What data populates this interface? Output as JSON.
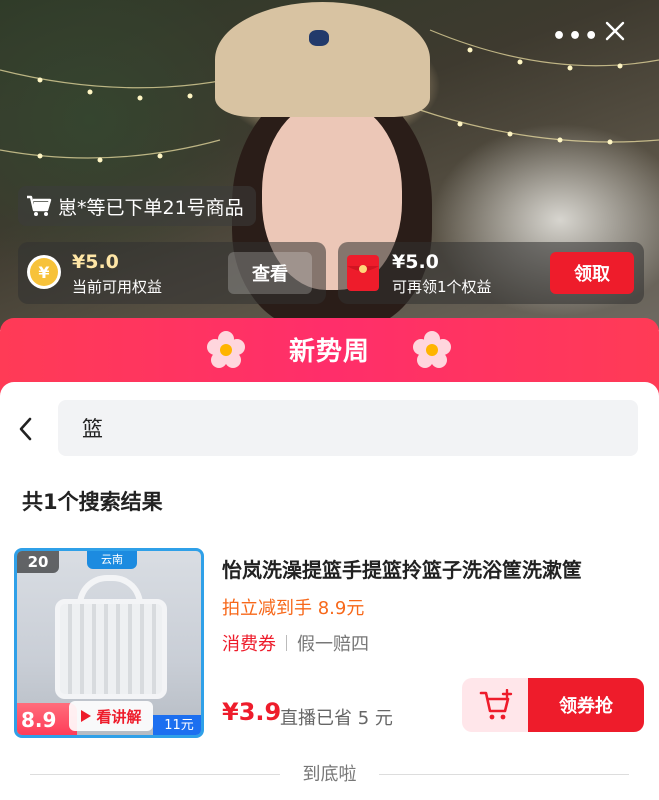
{
  "live_controls": {
    "more": "•••",
    "close": "✕"
  },
  "ticker": {
    "text": "崽*等已下单21号商品"
  },
  "benefits": {
    "current": {
      "amount": "¥5.0",
      "label": "当前可用权益",
      "button": "查看"
    },
    "claimable": {
      "amount": "¥5.0",
      "label": "可再领1个权益",
      "button": "领取"
    }
  },
  "banner": {
    "title": "新势周"
  },
  "search": {
    "query": "篮"
  },
  "results": {
    "count_text": "共1个搜索结果"
  },
  "product": {
    "thumb_badge": "20",
    "thumb_brand": "云南",
    "thumb_live_price": "8.9",
    "thumb_explain": "看讲解",
    "thumb_save": "11元",
    "title": "怡岚洗澡提篮手提篮拎篮子洗浴筐洗漱筐",
    "promo": "拍立减到手 8.9元",
    "tag_coupon": "消费券",
    "tag_guarantee": "假一赔四",
    "price": "¥3.9",
    "saved": "直播已省 5 元",
    "buy_button": "领券抢"
  },
  "footer": {
    "end_text": "到底啦"
  },
  "colors": {
    "accent": "#ee1c2b",
    "promo": "#f7681a",
    "banner": "#ff3b56"
  }
}
